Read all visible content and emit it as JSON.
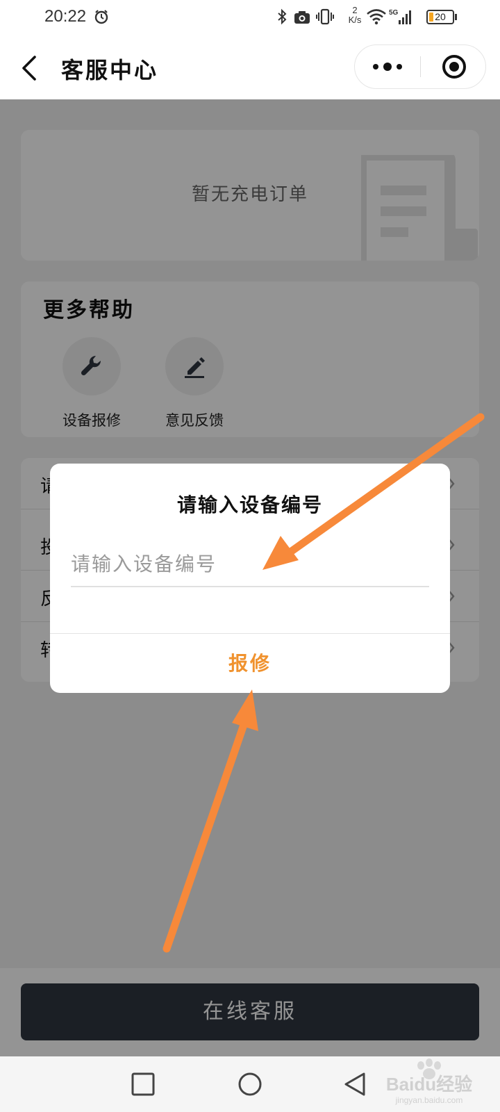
{
  "status_bar": {
    "time": "20:22",
    "net_speed_value": "2",
    "net_speed_unit": "K/s",
    "network_type": "5G",
    "battery_level": "20",
    "battery_fraction": 0.2,
    "icons": [
      "alarm-icon",
      "bluetooth-icon",
      "camera-icon",
      "vibrate-icon",
      "wifi-icon",
      "signal-icon",
      "battery-icon"
    ]
  },
  "title_bar": {
    "title": "客服中心",
    "icons": [
      "back-arrow-icon",
      "more-dots-icon",
      "close-target-icon"
    ]
  },
  "order_card": {
    "empty_text": "暂无充电订单"
  },
  "help_section": {
    "title": "更多帮助",
    "items": [
      {
        "label": "设备报修",
        "icon": "wrench-icon"
      },
      {
        "label": "意见反馈",
        "icon": "pencil-icon"
      }
    ]
  },
  "menu_rows": [
    {
      "label": "请"
    },
    {
      "label": "投"
    },
    {
      "label": "反"
    },
    {
      "label": "转"
    }
  ],
  "bottom": {
    "online_service_label": "在线客服"
  },
  "modal": {
    "title": "请输入设备编号",
    "input_placeholder": "请输入设备编号",
    "input_value": "",
    "confirm_label": "报修"
  },
  "nav_bar": {
    "icons": [
      "recent-apps-icon",
      "home-icon",
      "back-triangle-icon"
    ]
  },
  "watermark": {
    "brand": "Baidu经验",
    "url": "jingyan.baidu.com"
  },
  "colors": {
    "accent_orange": "#f0922e",
    "arrow_orange": "#f7893a",
    "dark_button": "#2f3640",
    "battery_fill": "#f5a623"
  }
}
